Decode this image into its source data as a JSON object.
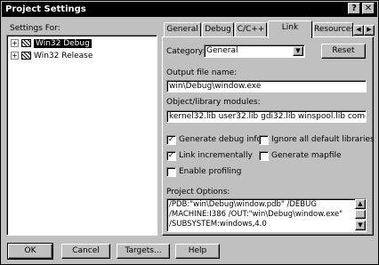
{
  "window": {
    "title": "Project Settings",
    "help_btn": "?",
    "close_btn": "✕"
  },
  "settings_for": {
    "label": "Settings For:",
    "items": [
      {
        "label": "Win32 Debug",
        "selected": true
      },
      {
        "label": "Win32 Release",
        "selected": false
      }
    ]
  },
  "tabs": [
    {
      "label": "General",
      "active": false
    },
    {
      "label": "Debug",
      "active": false
    },
    {
      "label": "C/C++",
      "active": false
    },
    {
      "label": "Link",
      "active": true
    },
    {
      "label": "Resources",
      "active": false
    }
  ],
  "tab_scroll": {
    "left": "◀",
    "right": "▶"
  },
  "link": {
    "category_label": "Category:",
    "category_value": "General",
    "reset_label": "Reset",
    "output_label": "Output file name:",
    "output_value": "win\\Debug\\window.exe",
    "modules_label": "Object/library modules:",
    "modules_value": "kernel32.lib user32.lib gdi32.lib winspool.lib comdlg32.lib ad",
    "checks": [
      {
        "label": "Generate debug info",
        "checked": true
      },
      {
        "label": "Ignore all default libraries",
        "checked": false
      },
      {
        "label": "Link incrementally",
        "checked": true
      },
      {
        "label": "Generate mapfile",
        "checked": false
      },
      {
        "label": "Enable profiling",
        "checked": false
      }
    ],
    "options_label": "Project Options:",
    "options_lines": [
      "/PDB:\"win\\Debug\\window.pdb\" /DEBUG",
      "/MACHINE:I386 /OUT:\"win\\Debug\\window.exe\"",
      "/SUBSYSTEM:windows,4.0"
    ]
  },
  "buttons": {
    "ok": "OK",
    "cancel": "Cancel",
    "targets": "Targets...",
    "help": "Help"
  }
}
